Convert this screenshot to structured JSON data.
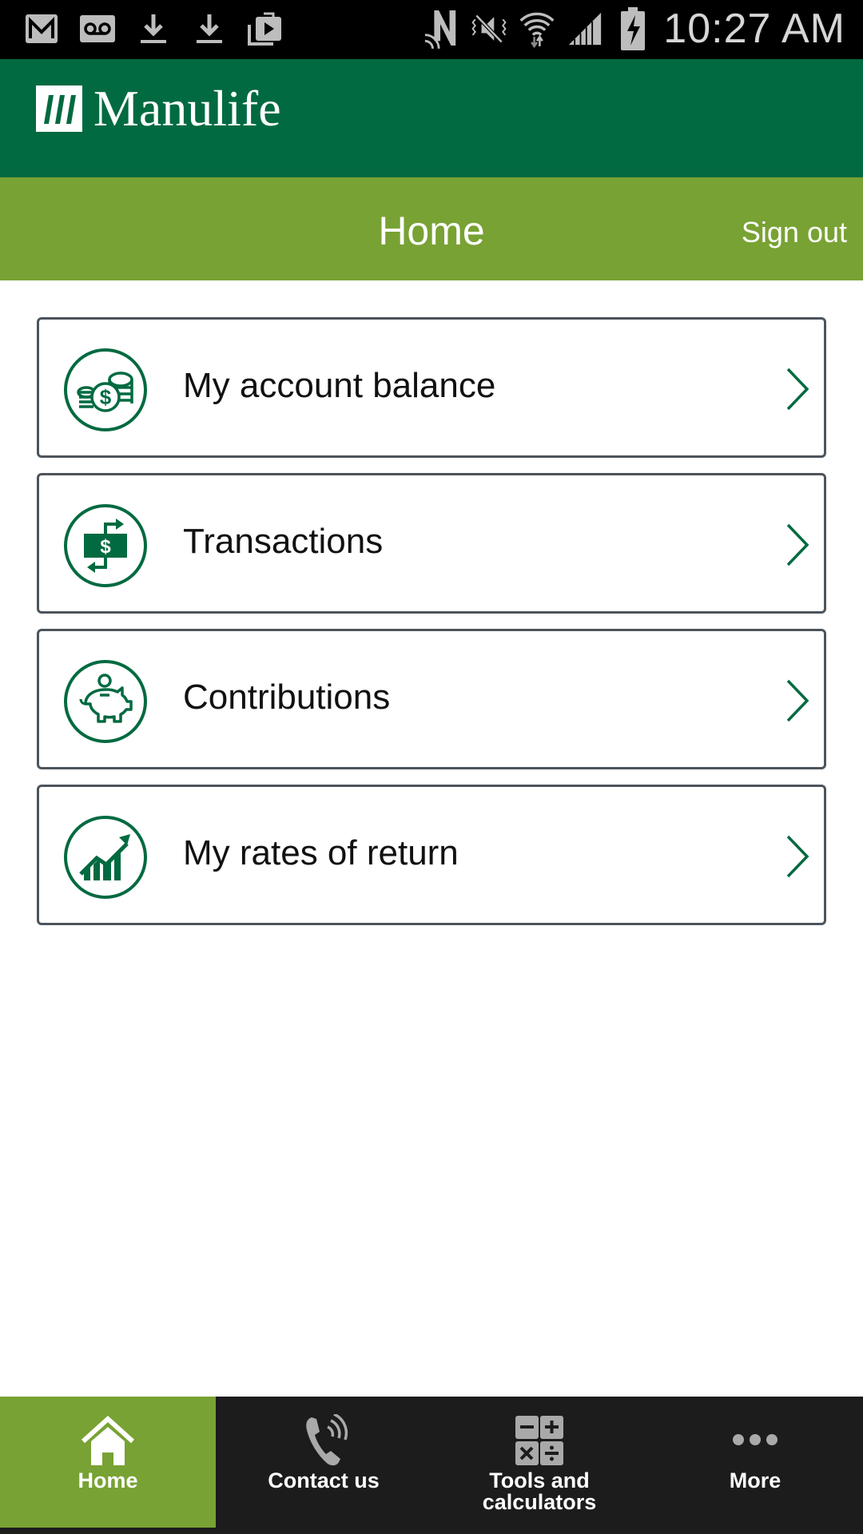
{
  "status_bar": {
    "left_icons": [
      "gmail-icon",
      "voicemail-icon",
      "download-icon",
      "download-icon",
      "play-store-icon"
    ],
    "right_icons": [
      "nfc-icon",
      "vibrate-mute-icon",
      "wifi-icon",
      "signal-icon",
      "battery-charging-icon"
    ],
    "time": "10:27 AM"
  },
  "brand": {
    "name": "Manulife",
    "color": "#016a40"
  },
  "title_bar": {
    "title": "Home",
    "sign_out": "Sign out",
    "color": "#78a233"
  },
  "menu": {
    "items": [
      {
        "label": "My account balance",
        "icon": "coins-dollar-icon"
      },
      {
        "label": "Transactions",
        "icon": "money-transfer-icon"
      },
      {
        "label": "Contributions",
        "icon": "piggy-bank-icon"
      },
      {
        "label": "My rates of return",
        "icon": "growth-chart-icon"
      }
    ]
  },
  "bottom_nav": {
    "items": [
      {
        "label": "Home",
        "icon": "home-icon",
        "active": true
      },
      {
        "label": "Contact us",
        "icon": "phone-icon",
        "active": false
      },
      {
        "label_line1": "Tools and",
        "label_line2": "calculators",
        "icon": "calculator-icon",
        "active": false
      },
      {
        "label": "More",
        "icon": "more-dots-icon",
        "active": false
      }
    ]
  }
}
